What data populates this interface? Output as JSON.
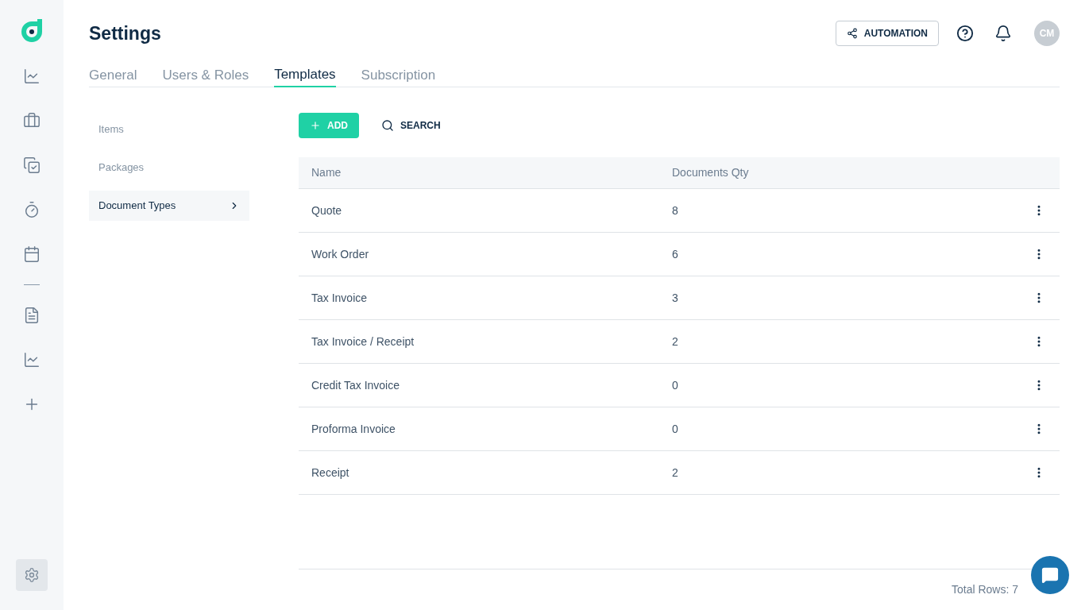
{
  "sidebar": {
    "items": [
      {
        "kind": "chart"
      },
      {
        "kind": "briefcase"
      },
      {
        "kind": "tasks"
      },
      {
        "kind": "timer"
      },
      {
        "kind": "calendar"
      },
      {
        "kind": "divider"
      },
      {
        "kind": "document"
      },
      {
        "kind": "chart"
      },
      {
        "kind": "plus"
      }
    ],
    "settings": {
      "selected": true
    }
  },
  "header": {
    "title": "Settings",
    "automation": "AUTOMATION",
    "avatar": "CM"
  },
  "tabs": [
    {
      "label": "General",
      "selected": false
    },
    {
      "label": "Users & Roles",
      "selected": false
    },
    {
      "label": "Templates",
      "selected": true
    },
    {
      "label": "Subscription",
      "selected": false
    }
  ],
  "submenu": [
    {
      "label": "Items",
      "selected": false
    },
    {
      "label": "Packages",
      "selected": false
    },
    {
      "label": "Document Types",
      "selected": true
    }
  ],
  "toolbar": {
    "add": "ADD",
    "search": "SEARCH"
  },
  "table": {
    "columns": [
      "Name",
      "Documents Qty"
    ],
    "rows": [
      {
        "name": "Quote",
        "qty": "8"
      },
      {
        "name": "Work Order",
        "qty": "6"
      },
      {
        "name": "Tax Invoice",
        "qty": "3"
      },
      {
        "name": "Tax Invoice / Receipt",
        "qty": "2"
      },
      {
        "name": "Credit Tax Invoice",
        "qty": "0"
      },
      {
        "name": "Proforma Invoice",
        "qty": "0"
      },
      {
        "name": "Receipt",
        "qty": "2"
      }
    ]
  },
  "footer": {
    "total": "Total Rows: 7"
  }
}
